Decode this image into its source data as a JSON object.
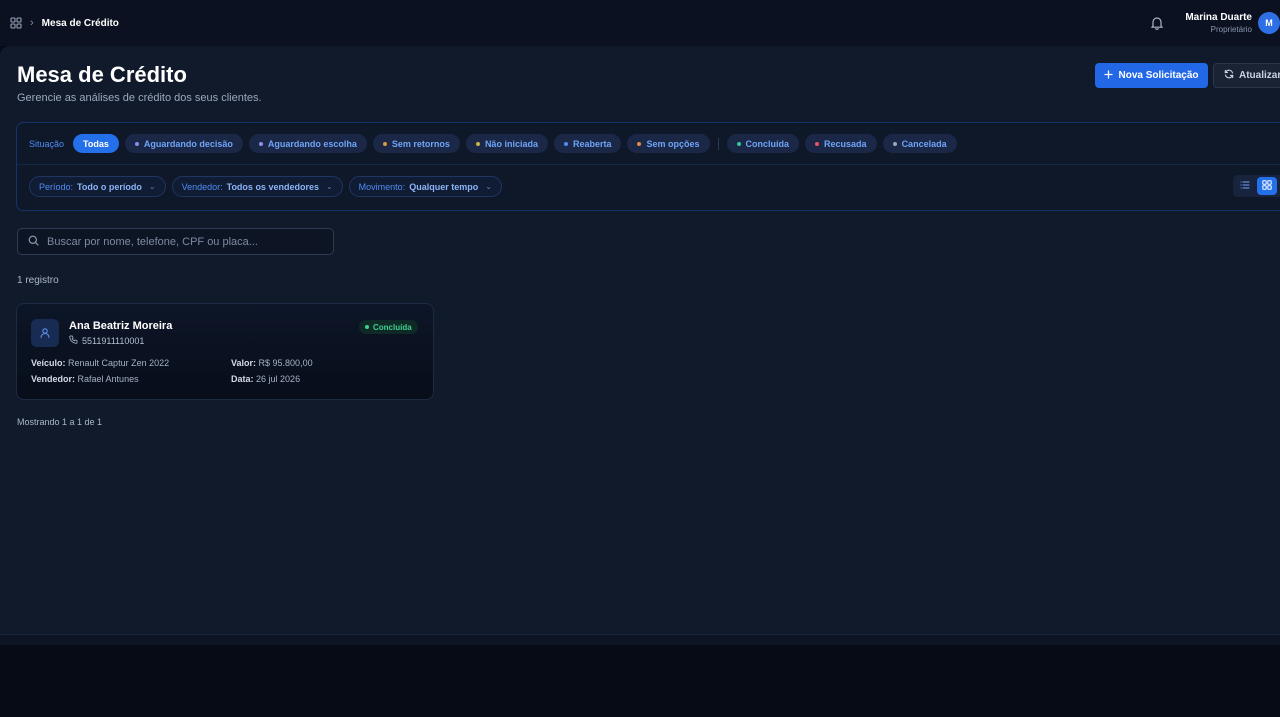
{
  "topbar": {
    "breadcrumb_title": "Mesa de Crédito",
    "user": {
      "name": "Marina Duarte",
      "role": "Proprietário",
      "initial": "M"
    }
  },
  "header": {
    "title": "Mesa de Crédito",
    "subtitle": "Gerencie as análises de crédito dos seus clientes.",
    "new_button": "Nova Solicitação",
    "refresh_button": "Atualizar"
  },
  "filters": {
    "status_label": "Situação",
    "statuses": [
      {
        "label": "Todas",
        "active": true,
        "dot": ""
      },
      {
        "label": "Aguardando decisão",
        "dot": "#7f8ff0"
      },
      {
        "label": "Aguardando escolha",
        "dot": "#8c90e8"
      },
      {
        "label": "Sem retornos",
        "dot": "#d99a3c"
      },
      {
        "label": "Não iniciada",
        "dot": "#c9b24a"
      },
      {
        "label": "Reaberta",
        "dot": "#4f8df4"
      },
      {
        "label": "Sem opções",
        "dot": "#e0894a"
      },
      {
        "label": "Concluída",
        "dot": "#2fc7a0"
      },
      {
        "label": "Recusada",
        "dot": "#e8536a"
      },
      {
        "label": "Cancelada",
        "dot": "#9aa6bd"
      }
    ],
    "period": {
      "label": "Período:",
      "value": "Todo o período"
    },
    "seller": {
      "label": "Vendedor:",
      "value": "Todos os vendedores"
    },
    "movement": {
      "label": "Movimento:",
      "value": "Qualquer tempo"
    },
    "view_mode": "grid"
  },
  "search": {
    "placeholder": "Buscar por nome, telefone, CPF ou placa..."
  },
  "results": {
    "count_text": "1 registro",
    "cards": [
      {
        "name": "Ana Beatriz Moreira",
        "phone": "5511911110001",
        "status": "Concluída",
        "vehicle_label": "Veículo:",
        "vehicle": "Renault Captur Zen 2022",
        "value_label": "Valor:",
        "value": "R$ 95.800,00",
        "seller_label": "Vendedor:",
        "seller": "Rafael Antunes",
        "date_label": "Data:",
        "date": "26 jul 2026"
      }
    ],
    "pagination": "Mostrando 1 a 1 de 1"
  },
  "colors": {
    "accent": "#2470ea",
    "success": "#3fd08e",
    "background": "#111a2a"
  }
}
